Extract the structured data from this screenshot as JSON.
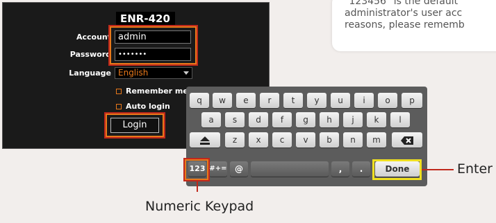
{
  "login": {
    "title": "ENR-420",
    "account_label": "Account",
    "account_value": "admin",
    "password_label": "Password",
    "password_value": "•••••••",
    "language_label": "Language",
    "language_value": "English",
    "remember_label": "Remember me",
    "autologin_label": "Auto login",
    "login_button": "Login"
  },
  "note": {
    "line1": "\"123456\" is the default",
    "line2": "administrator's user acc",
    "line3": "reasons, please rememb"
  },
  "keyboard": {
    "row1": [
      "q",
      "w",
      "e",
      "r",
      "t",
      "y",
      "u",
      "i",
      "o",
      "p"
    ],
    "row2": [
      "a",
      "s",
      "d",
      "f",
      "g",
      "h",
      "j",
      "k",
      "l"
    ],
    "row3": [
      "z",
      "x",
      "c",
      "v",
      "b",
      "n",
      "m"
    ],
    "numeric_key": "123",
    "symbols_key": "#+=",
    "at_key": "@",
    "comma_key": ",",
    "period_key": ".",
    "done_key": "Done"
  },
  "callouts": {
    "enter": "Enter",
    "numeric_keypad": "Numeric Keypad"
  },
  "colors": {
    "highlight_orange": "#e8781a",
    "highlight_red": "#c0281c",
    "highlight_yellow": "#f0e020",
    "language_text": "#e8781a"
  },
  "icons": {
    "shift": "eject-icon",
    "backspace": "backspace-icon"
  }
}
